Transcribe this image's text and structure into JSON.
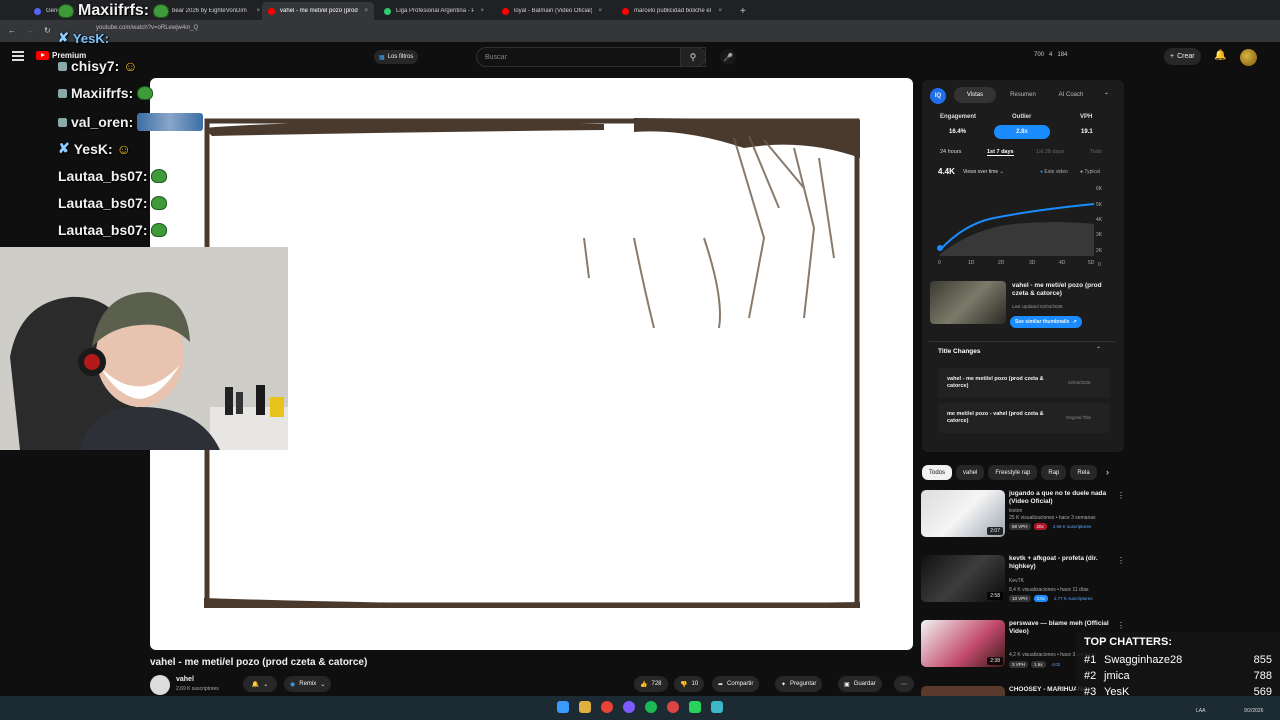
{
  "browser": {
    "tabs": [
      {
        "label": "General",
        "fav": "#5865f2"
      },
      {
        "label": "bear 2026 by EighteVonDim",
        "fav": "#888"
      },
      {
        "label": "vahel - me meti/el pozo (prod",
        "fav": "#ff0000",
        "active": true
      },
      {
        "label": "Liga Profesional Argentina - Pl",
        "fav": "#2ecc71"
      },
      {
        "label": "loyal - Balmain (Video Oficial)",
        "fav": "#ff0000"
      },
      {
        "label": "marcelo publicidad boliche el l",
        "fav": "#ff0000"
      }
    ],
    "new_tab": "+",
    "url": "youtube.com/watch?v=oRLewjw4m_Q"
  },
  "header": {
    "logo": "Premium",
    "filters": "Los filtros",
    "search_placeholder": "Buscar",
    "stats": [
      "700",
      "4",
      "184"
    ],
    "create": "Crear"
  },
  "chat": [
    {
      "user": "Maxiifrfs:",
      "color": "#ffffff",
      "badge": "frog"
    },
    {
      "user": "YesK:",
      "color": "#ffffff",
      "badge": "sword"
    },
    {
      "user": "chisy7:",
      "color": "#ffffff",
      "badge": "frog"
    },
    {
      "user": "Maxiifrfs:",
      "color": "#ffffff",
      "badge": "frog"
    },
    {
      "user": "val_oren:",
      "color": "#ffffff",
      "badge": "frog"
    },
    {
      "user": "YesK:",
      "color": "#ffffff",
      "badge": "sword"
    },
    {
      "user": "Lautaa_bs07:",
      "color": "#ffffff",
      "badge": ""
    },
    {
      "user": "Lautaa_bs07:",
      "color": "#ffffff",
      "badge": ""
    },
    {
      "user": "Lautaa_bs07:",
      "color": "#ffffff",
      "badge": ""
    }
  ],
  "video": {
    "title": "vahel - me meti/el pozo (prod czeta & catorce)",
    "channel": "vahel",
    "subs": "2,69 K suscriptores",
    "remix": "Remix",
    "likes": "728",
    "dislikes": "10",
    "share": "Compartir",
    "ask": "Preguntar",
    "save": "Guardar"
  },
  "panel": {
    "logo": "IQ",
    "tabs": [
      "Vistas",
      "Resumen",
      "AI Coach"
    ],
    "metrics": [
      {
        "label": "Engagement",
        "value": "16.4%"
      },
      {
        "label": "Outlier",
        "value": "2.8x"
      },
      {
        "label": "VPH",
        "value": "19.1"
      }
    ],
    "ranges": [
      "24 hours",
      "1st 7 days",
      "1st 28 days",
      "Todo"
    ],
    "views": "4.4K",
    "views_over_time": "Views over time",
    "legend_this": "Este video",
    "legend_typical": "Typical",
    "y_ticks": [
      "6K",
      "5K",
      "4K",
      "3K",
      "2K",
      "1K",
      "0"
    ],
    "x_ticks": [
      "0",
      "1D",
      "2D",
      "3D",
      "4D",
      "5D"
    ],
    "card_title": "vahel - me meti/el pozo (prod czeta & catorce)",
    "card_updated": "Last Updated 02/04/2026",
    "similar_btn": "See similar thumbnails",
    "title_changes": "Title Changes",
    "changes": [
      {
        "title": "vahel - me meti/el pozo (prod czeta & catorce)",
        "date": "02/04/2026"
      },
      {
        "title": "me meti/el pozo - vahel (prod czeta & catorce)",
        "date": "Original Title"
      }
    ]
  },
  "chips": [
    "Todos",
    "vahel",
    "Freestyle rap",
    "Rap",
    "Rela"
  ],
  "recs": [
    {
      "title": "jugando a que no te duele nada (Video Oficial)",
      "channel": "leston",
      "meta": "25 K visualizaciones • hace 3 semanas",
      "dur": "2:07",
      "tags": [
        "58 VPH",
        "20x",
        "2,56 K suscriptores"
      ]
    },
    {
      "title": "kevtk + afkgoat - profeta (dir. highkey)",
      "channel": "KevTK",
      "meta": "8,4 K visualizaciones • hace 11 días",
      "dur": "2:58",
      "tags": [
        "10 VPH",
        "3.5x",
        "2,77 K suscriptores"
      ]
    },
    {
      "title": "perswave — blame meh (Official Video)",
      "channel": "",
      "meta": "4,2 K visualizaciones • hace 3 semanas",
      "dur": "2:38",
      "tags": [
        "3 VPH",
        "1.6x",
        "4,02"
      ]
    },
    {
      "title": "CHOOSEY - MARIHUANA",
      "channel": "",
      "meta": "",
      "dur": "",
      "tags": []
    }
  ],
  "top_chatters": {
    "title": "TOP CHATTERS:",
    "rows": [
      {
        "rank": "#1",
        "name": "Swagginhaze28",
        "count": "855"
      },
      {
        "rank": "#2",
        "name": "jmica",
        "count": "788"
      },
      {
        "rank": "#3",
        "name": "YesK",
        "count": "569"
      }
    ]
  },
  "taskbar": {
    "lang": "LAA",
    "date": "9/2/2026"
  }
}
